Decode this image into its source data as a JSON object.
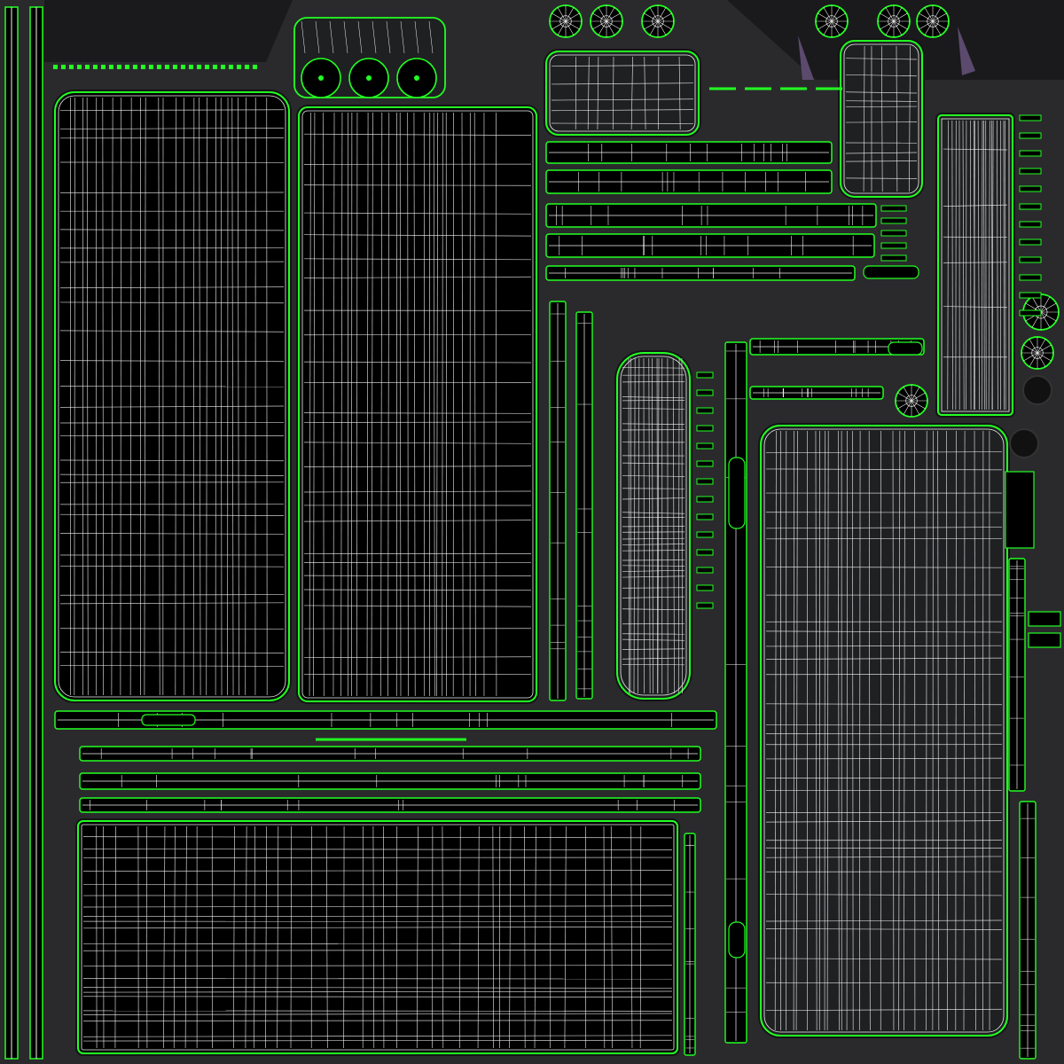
{
  "texture": {
    "kind": "uv-wireframe-layout",
    "colors": {
      "background": "#2a2a2c",
      "backdrop_dark": "#141416",
      "island_fill": "#000000",
      "island_fill_alt": "#1f2022",
      "edge_green": "#22ff22",
      "mesh_white": "#f2f2f2",
      "shadow_purple": "#4a3f5a"
    },
    "legend_text": []
  }
}
